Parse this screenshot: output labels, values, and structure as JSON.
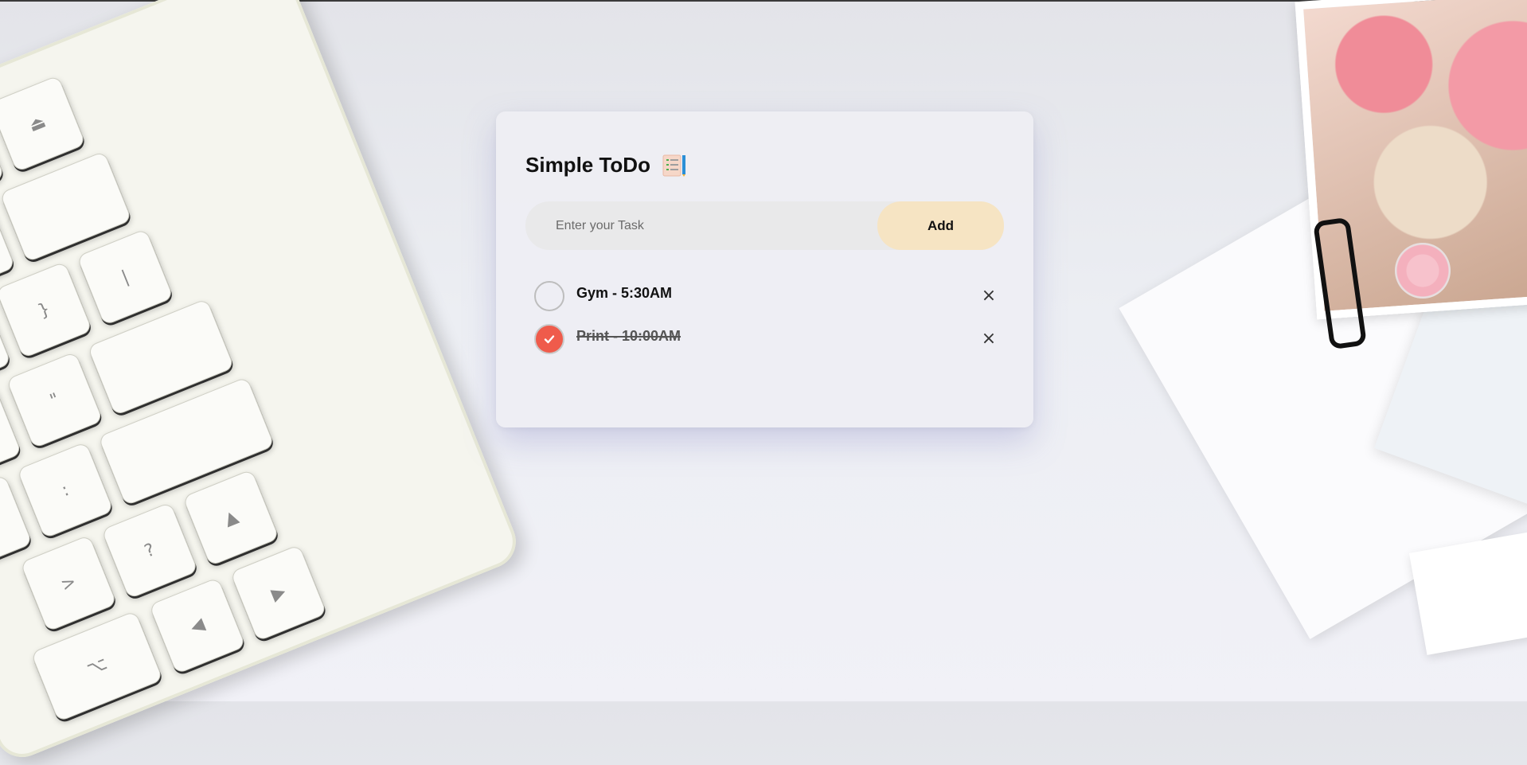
{
  "app": {
    "title": "Simple ToDo",
    "title_icon": "clipboard-list-icon"
  },
  "form": {
    "placeholder": "Enter your Task",
    "add_label": "Add"
  },
  "tasks": [
    {
      "text": "Gym - 5:30AM",
      "done": false,
      "delete_symbol": "×"
    },
    {
      "text": "Print - 10:00AM",
      "done": true,
      "delete_symbol": "×"
    }
  ],
  "colors": {
    "accent_check": "#ef5b4b",
    "add_button": "#f6e4c3"
  }
}
